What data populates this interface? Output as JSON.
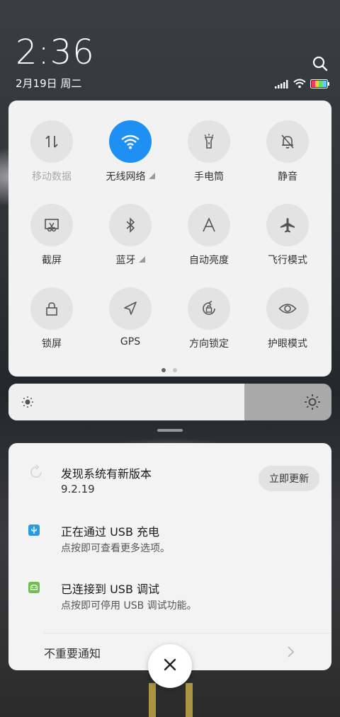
{
  "status": {
    "time": "2:36",
    "date": "2月19日 周二",
    "icons": [
      "signal-icon",
      "wifi-icon",
      "battery-icon"
    ]
  },
  "quick_settings": {
    "tiles": [
      {
        "label": "移动数据",
        "icon": "mobile-data-icon",
        "active": false,
        "dim": true
      },
      {
        "label": "无线网络",
        "icon": "wifi-icon",
        "active": true,
        "dim": false
      },
      {
        "label": "手电筒",
        "icon": "flashlight-icon",
        "active": false,
        "dim": false
      },
      {
        "label": "静音",
        "icon": "mute-bell-icon",
        "active": false,
        "dim": false
      },
      {
        "label": "截屏",
        "icon": "screenshot-icon",
        "active": false,
        "dim": false
      },
      {
        "label": "蓝牙",
        "icon": "bluetooth-icon",
        "active": false,
        "dim": false
      },
      {
        "label": "自动亮度",
        "icon": "auto-brightness-icon",
        "active": false,
        "dim": false
      },
      {
        "label": "飞行模式",
        "icon": "airplane-icon",
        "active": false,
        "dim": false
      },
      {
        "label": "锁屏",
        "icon": "lock-icon",
        "active": false,
        "dim": false
      },
      {
        "label": "GPS",
        "icon": "gps-icon",
        "active": false,
        "dim": false
      },
      {
        "label": "方向锁定",
        "icon": "rotation-lock-icon",
        "active": false,
        "dim": false
      },
      {
        "label": "护眼模式",
        "icon": "eye-icon",
        "active": false,
        "dim": false
      }
    ],
    "page_count": 2,
    "current_page": 1
  },
  "brightness": {
    "level": 0.73
  },
  "notifications": [
    {
      "title": "发现系统有新版本",
      "subtitle": "9.2.19",
      "action": "立即更新",
      "icon": "update-icon"
    },
    {
      "title": "正在通过 USB 充电",
      "subtitle": "点按即可查看更多选项。",
      "icon": "usb-icon"
    },
    {
      "title": "已连接到 USB 调试",
      "subtitle": "点按即可停用 USB 调试功能。",
      "icon": "android-debug-icon"
    }
  ],
  "minor_notifications_label": "不重要通知",
  "colors": {
    "accent": "#1e90f4",
    "panel": "#f2f2f2"
  }
}
